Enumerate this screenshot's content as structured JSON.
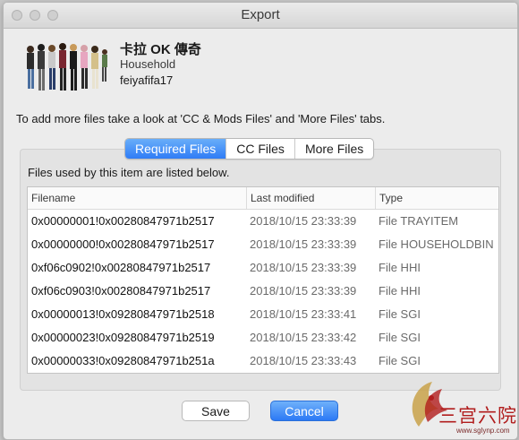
{
  "window": {
    "title": "Export"
  },
  "household": {
    "name": "卡拉 OK 傳奇",
    "type": "Household",
    "author": "feiyafifa17"
  },
  "hint": "To add more files take a look at 'CC & Mods Files' and 'More Files' tabs.",
  "tabs": [
    {
      "label": "Required Files",
      "active": true
    },
    {
      "label": "CC Files",
      "active": false
    },
    {
      "label": "More Files",
      "active": false
    }
  ],
  "caption": "Files used by this item are listed below.",
  "table": {
    "columns": [
      "Filename",
      "Last modified",
      "Type"
    ],
    "rows": [
      [
        "0x00000001!0x00280847971b2517",
        "2018/10/15 23:33:39",
        "File TRAYITEM"
      ],
      [
        "0x00000000!0x00280847971b2517",
        "2018/10/15 23:33:39",
        "File HOUSEHOLDBIN"
      ],
      [
        "0xf06c0902!0x00280847971b2517",
        "2018/10/15 23:33:39",
        "File HHI"
      ],
      [
        "0xf06c0903!0x00280847971b2517",
        "2018/10/15 23:33:39",
        "File HHI"
      ],
      [
        "0x00000013!0x09280847971b2518",
        "2018/10/15 23:33:41",
        "File SGI"
      ],
      [
        "0x00000023!0x09280847971b2519",
        "2018/10/15 23:33:42",
        "File SGI"
      ],
      [
        "0x00000033!0x09280847971b251a",
        "2018/10/15 23:33:43",
        "File SGI"
      ]
    ]
  },
  "buttons": {
    "save": "Save",
    "cancel": "Cancel"
  },
  "watermark": {
    "text": "三宫六院",
    "url": "www.sglynp.com"
  },
  "colors": {
    "accent": "#2f7cf6",
    "watermark": "#b11d1d"
  }
}
